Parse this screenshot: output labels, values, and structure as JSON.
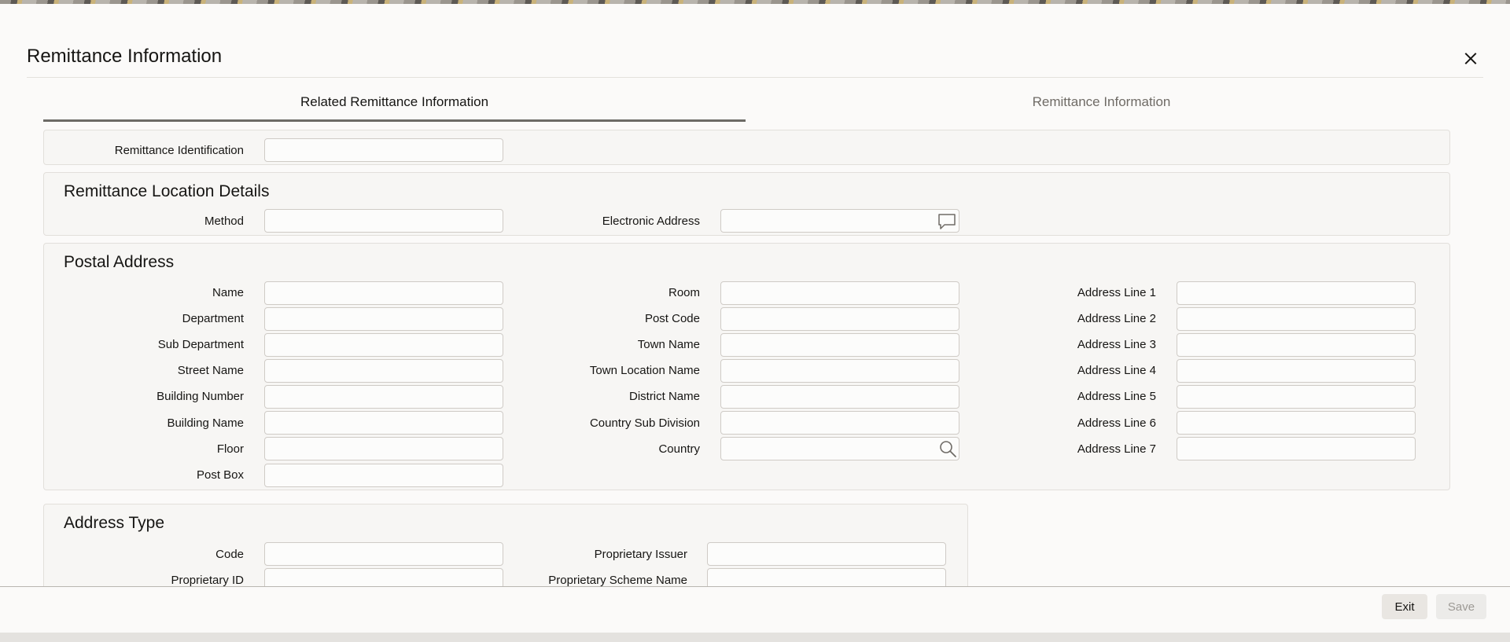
{
  "dialog": {
    "title": "Remittance Information"
  },
  "tabs": [
    {
      "label": "Related Remittance Information",
      "active": true
    },
    {
      "label": "Remittance Information",
      "active": false
    }
  ],
  "identification": {
    "label": "Remittance Identification",
    "value": ""
  },
  "location": {
    "title": "Remittance Location Details",
    "method_label": "Method",
    "method_value": "",
    "electronic_label": "Electronic Address",
    "electronic_value": ""
  },
  "postal": {
    "title": "Postal Address",
    "col1": [
      {
        "label": "Name",
        "value": ""
      },
      {
        "label": "Department",
        "value": ""
      },
      {
        "label": "Sub Department",
        "value": ""
      },
      {
        "label": "Street Name",
        "value": ""
      },
      {
        "label": "Building Number",
        "value": ""
      },
      {
        "label": "Building Name",
        "value": ""
      },
      {
        "label": "Floor",
        "value": ""
      },
      {
        "label": "Post Box",
        "value": ""
      }
    ],
    "col2": [
      {
        "label": "Room",
        "value": ""
      },
      {
        "label": "Post Code",
        "value": ""
      },
      {
        "label": "Town Name",
        "value": ""
      },
      {
        "label": "Town Location Name",
        "value": ""
      },
      {
        "label": "District Name",
        "value": ""
      },
      {
        "label": "Country Sub Division",
        "value": ""
      },
      {
        "label": "Country",
        "value": ""
      }
    ],
    "col3": [
      {
        "label": "Address Line 1",
        "value": ""
      },
      {
        "label": "Address Line 2",
        "value": ""
      },
      {
        "label": "Address Line 3",
        "value": ""
      },
      {
        "label": "Address Line 4",
        "value": ""
      },
      {
        "label": "Address Line 5",
        "value": ""
      },
      {
        "label": "Address Line 6",
        "value": ""
      },
      {
        "label": "Address Line 7",
        "value": ""
      }
    ]
  },
  "address_type": {
    "title": "Address Type",
    "code_label": "Code",
    "code_value": "",
    "prop_id_label": "Proprietary ID",
    "prop_id_value": "",
    "issuer_label": "Proprietary Issuer",
    "issuer_value": "",
    "scheme_label": "Proprietary Scheme Name",
    "scheme_value": ""
  },
  "icons": {
    "electronic_address": "message-icon",
    "country_lookup": "search-icon",
    "close": "close-icon"
  },
  "footer": {
    "exit_label": "Exit",
    "save_label": "Save"
  }
}
